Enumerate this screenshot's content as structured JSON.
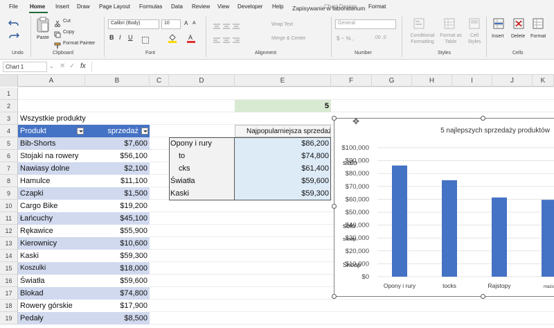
{
  "menu": {
    "tabs": [
      "File",
      "Home",
      "Insert",
      "Draw",
      "Page Layout",
      "Formulas",
      "Data",
      "Review",
      "View",
      "Developer",
      "Help",
      "Chart Design",
      "Format"
    ],
    "active": "Home"
  },
  "window_title": "Zapisywanie w laboratorium",
  "ribbon": {
    "undo_label": "Undo",
    "paste_label": "Paste",
    "cut_label": "Cut",
    "copy_label": "Copy",
    "format_painter_label": "Format Painter",
    "clipboard_label": "Clipboard",
    "font_name": "Calibri (Body)",
    "font_size": "10",
    "font_label": "Font",
    "wrap_text_label": "Wrap Text",
    "merge_center_label": "Merge & Center",
    "alignment_label": "Alignment",
    "number_format": "General",
    "number_label": "Number",
    "conditional_formatting_label": "Conditional Formatting",
    "format_as_table_label": "Format as Table",
    "cell_styles_label": "Cell Styles",
    "styles_label": "Styles",
    "insert_label": "Insert",
    "delete_label": "Delete",
    "format_label": "Format",
    "cells_label": "Cells"
  },
  "formula_bar": {
    "name_box": "Chart 1",
    "fx": "fx",
    "content": ""
  },
  "columns": [
    "A",
    "B",
    "C",
    "D",
    "E",
    "F",
    "G",
    "H",
    "I",
    "J",
    "K"
  ],
  "rows": [
    "1",
    "2",
    "3",
    "4",
    "5",
    "6",
    "7",
    "8",
    "9",
    "10",
    "11",
    "12",
    "13",
    "14",
    "15",
    "16",
    "17",
    "18",
    "19"
  ],
  "sheet": {
    "e2_value": "5",
    "a3_title": "Wszystkie produkty",
    "table_headers": {
      "product": "Produkt",
      "sales": "sprzedaż"
    },
    "products": [
      {
        "name": "Bib-Shorts",
        "sales": "$7,600"
      },
      {
        "name": "Stojaki na rowery",
        "sales": "$56,100"
      },
      {
        "name": "Nawiasy dolne",
        "sales": "$2,100"
      },
      {
        "name": "Hamulce",
        "sales": "$11,100"
      },
      {
        "name": "Czapki",
        "sales": "$1,500"
      },
      {
        "name": "Cargo Bike",
        "sales": "$19,200"
      },
      {
        "name": "Łańcuchy",
        "sales": "$45,100"
      },
      {
        "name": "Rękawice",
        "sales": "$55,900"
      },
      {
        "name": "Kierownicy",
        "sales": "$10,600"
      },
      {
        "name": "Kaski",
        "sales": "$59,300"
      },
      {
        "name": "Koszulki",
        "sales": "$18,000"
      },
      {
        "name": "Światła",
        "sales": "$59,600"
      },
      {
        "name": "Blokad",
        "sales": "$74,800"
      },
      {
        "name": "Rowery górskie",
        "sales": "$17,900"
      },
      {
        "name": "Pedały",
        "sales": "$8,500"
      }
    ],
    "top_header": "Najpopularniejsza sprzedaż produktów S",
    "top_products": [
      {
        "name": "Opony i rury",
        "sales": "$86,200"
      },
      {
        "name": "to",
        "sales": "$74,800"
      },
      {
        "name": "cks",
        "sales": "$61,400"
      },
      {
        "name": "Światła",
        "sales": "$59,600"
      },
      {
        "name": "Kaski",
        "sales": "$59,300"
      }
    ]
  },
  "colors": {
    "table_header": "#4472c4",
    "band": "#d0d9ee",
    "bar": "#4472c4",
    "highlight_green": "#d9ead3",
    "highlight_blue": "#ddebf7",
    "accent": "#217346"
  },
  "chart_data": {
    "type": "bar",
    "title": "5 najlepszych sprzedaży produktów",
    "categories": [
      "Opony i rury",
      "tocks",
      "Rajstopy",
      "mazio"
    ],
    "values": [
      86200,
      74800,
      61400,
      59600
    ],
    "ylim": [
      0,
      100000
    ],
    "yticks": [
      "$0",
      "$10,000",
      "$20,000",
      "$30,000",
      "$40,000",
      "$50,000",
      "$60,000",
      "$70,000",
      "$80,000",
      "$90,000",
      "$100,000"
    ],
    "overlay_labels": [
      "sialo",
      "solo",
      "snoop",
      "Snoop"
    ],
    "grid": true
  }
}
